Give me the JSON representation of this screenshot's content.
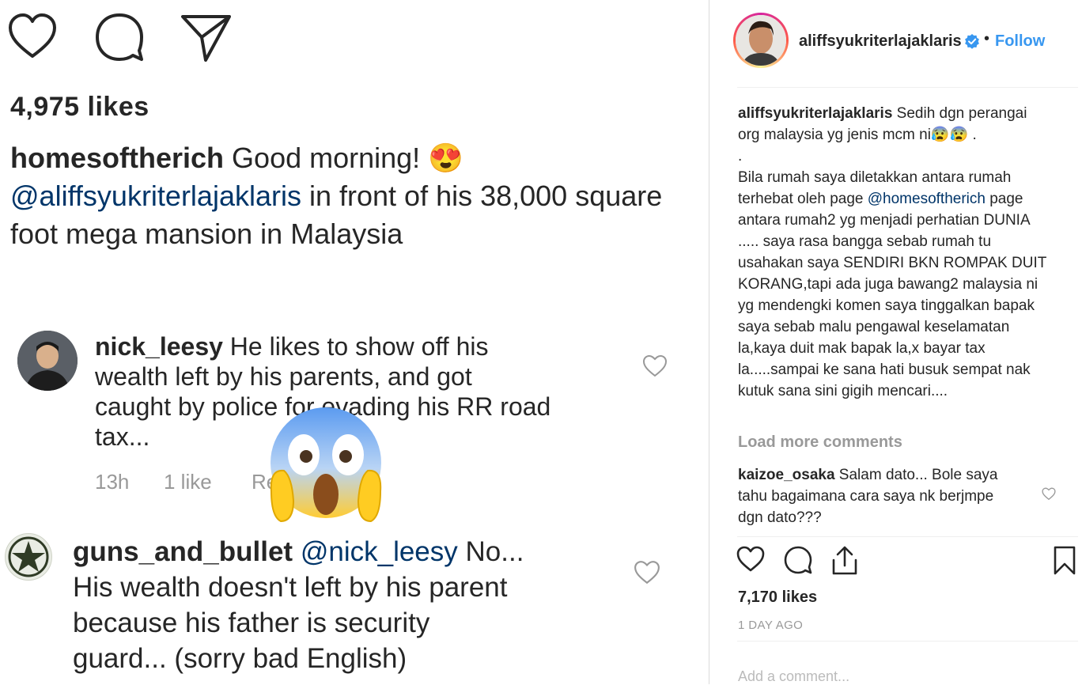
{
  "left_post": {
    "likes": "4,975 likes",
    "caption": {
      "username": "homesoftherich",
      "text1": " Good morning! ",
      "emoji": "😍",
      "mention": "@aliffsyukriterlajaklaris",
      "text2": " in front of his 38,000 square",
      "text3": "foot mega mansion in Malaysia"
    },
    "comments": [
      {
        "username": "nick_leesy",
        "lines": [
          " He likes to show off his",
          "wealth left by his parents, and got",
          "caught by police for evading his RR road",
          "tax..."
        ],
        "time": "13h",
        "likes": "1 like",
        "reply": "Reply"
      },
      {
        "username": "guns_and_bullet",
        "mention": "@nick_leesy",
        "lines": [
          " No...",
          "His wealth doesn't left by his parent",
          "because his father is security",
          "guard... (sorry bad English)"
        ]
      }
    ],
    "overlay_emoji": "😱"
  },
  "sidebar": {
    "username": "aliffsyukriterlajaklaris",
    "follow": "Follow",
    "dot": "•",
    "caption": {
      "username": "aliffsyukriterlajaklaris",
      "line1": " Sedih dgn perangai",
      "line2": "org malaysia yg jenis mcm ni😰😰 .",
      "line3": ".",
      "para_before_mention": "Bila rumah saya diletakkan antara rumah terhebat oleh page ",
      "mention": "@homesoftherich",
      "para_after_mention": " page antara rumah2 yg menjadi perhatian DUNIA ..... saya rasa bangga sebab rumah tu usahakan saya SENDIRI BKN ROMPAK DUIT KORANG,tapi ada juga bawang2 malaysia ni yg mendengki komen saya tinggalkan bapak saya sebab malu pengawal keselamatan la,kaya duit mak bapak la,x bayar tax la.....sampai ke sana hati busuk sempat nak kutuk sana sini gigih mencari...."
    },
    "load_more": "Load more comments",
    "comment": {
      "username": "kaizoe_osaka",
      "text": " Salam dato... Bole saya tahu bagaimana cara saya nk berjmpe dgn dato???"
    },
    "likes": "7,170 likes",
    "time": "1 DAY AGO",
    "add_comment_placeholder": "Add a comment..."
  }
}
